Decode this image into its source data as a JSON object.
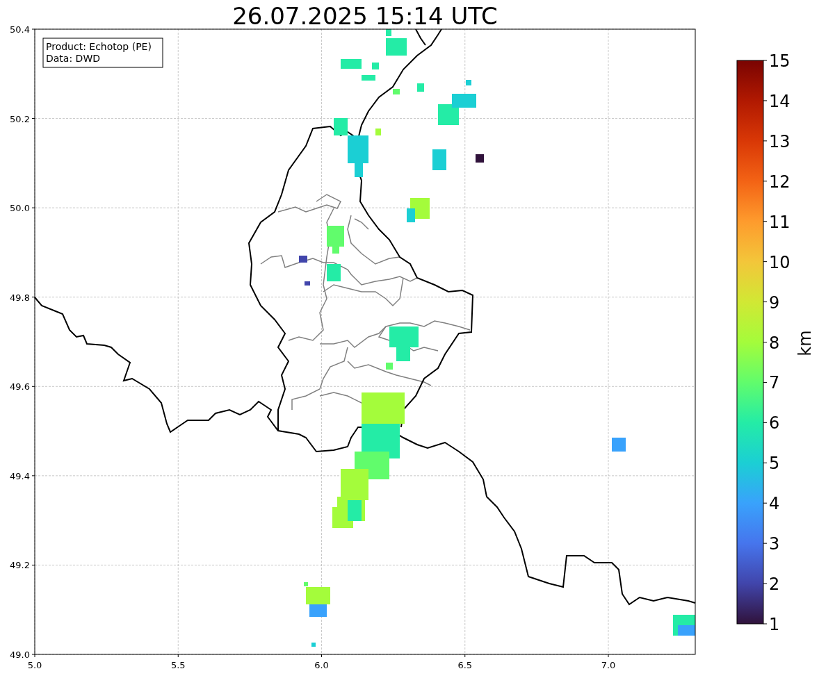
{
  "title": "26.07.2025 15:14 UTC",
  "legend": {
    "lines": [
      "Product: Echotop (PE)",
      "Data: DWD"
    ]
  },
  "axes": {
    "xticks": [
      "5.0",
      "5.5",
      "6.0",
      "6.5",
      "7.0"
    ],
    "yticks": [
      "50.4",
      "50.2",
      "50.0",
      "49.8",
      "49.6",
      "49.4",
      "49.2",
      "49.0"
    ]
  },
  "colorbar": {
    "label": "km",
    "ticks": [
      "15",
      "14",
      "13",
      "12",
      "11",
      "10",
      "9",
      "8",
      "7",
      "6",
      "5",
      "4",
      "3",
      "2",
      "1"
    ]
  }
}
